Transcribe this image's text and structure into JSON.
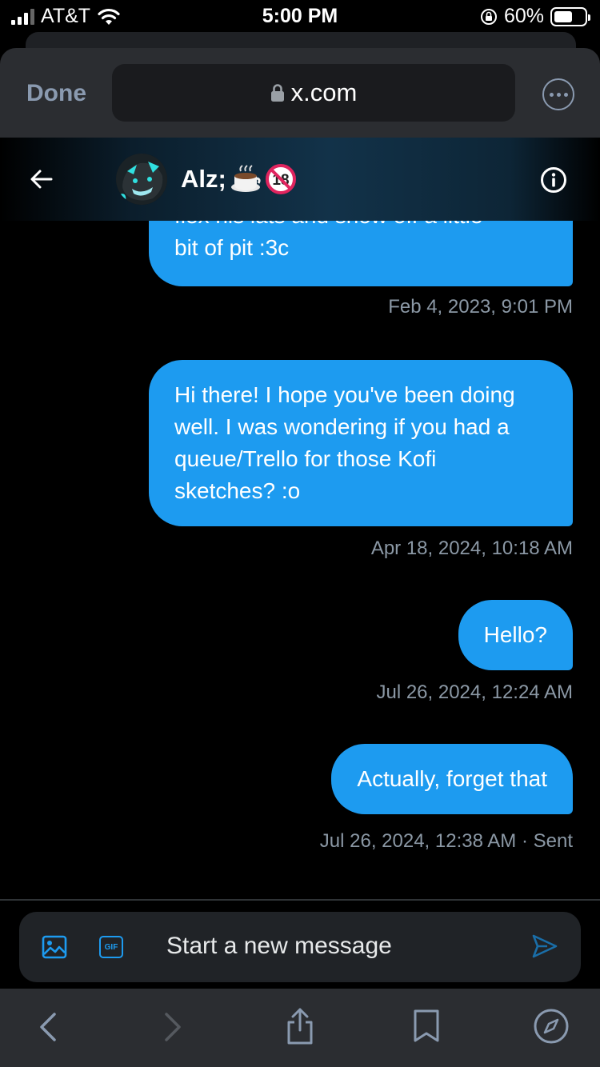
{
  "status_bar": {
    "carrier": "AT&T",
    "time": "5:00 PM",
    "battery": "60%",
    "battery_level": 0.6
  },
  "browser": {
    "done_label": "Done",
    "url": "x.com"
  },
  "conversation": {
    "name": "Alz;"
  },
  "messages": [
    {
      "text": [
        "flex his lats and show off a little",
        "bit of pit :3c"
      ],
      "timestamp": "Feb 4, 2023, 9:01 PM"
    },
    {
      "text": [
        "Hi there! I hope you've been doing",
        "well. I was wondering if you had a",
        "queue/Trello for those Kofi",
        "sketches? :o"
      ],
      "timestamp": "Apr 18, 2024, 10:18 AM"
    },
    {
      "text": [
        "Hello?"
      ],
      "timestamp": "Jul 26, 2024, 12:24 AM"
    },
    {
      "text": [
        "Actually, forget that"
      ],
      "timestamp": "Jul 26, 2024, 12:38 AM · Sent"
    }
  ],
  "composer": {
    "placeholder": "Start a new message",
    "gif_label": "GIF"
  },
  "colors": {
    "accent": "#1d9bf0",
    "background": "#000000",
    "muted_text": "#8b98a5"
  }
}
